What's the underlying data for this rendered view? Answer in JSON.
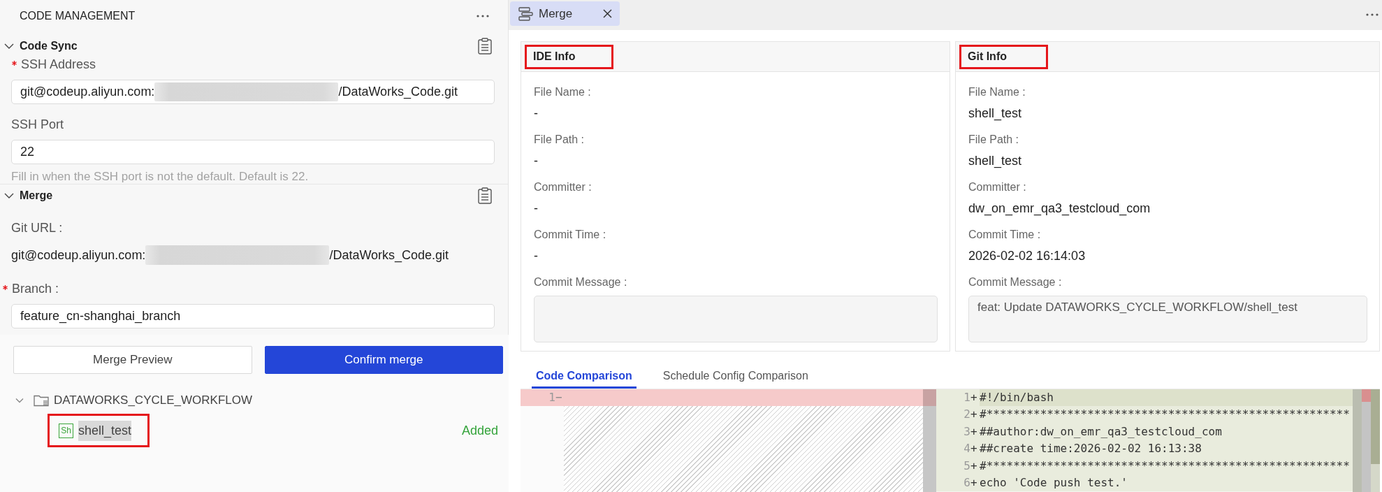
{
  "sidebar": {
    "title": "CODE MANAGEMENT",
    "sections": [
      {
        "title": "Code Sync",
        "expanded": true,
        "fields": [
          {
            "kind": "input",
            "label": "SSH Address",
            "required": true,
            "value": "git@codeup.aliyun.com:",
            "redacted": true,
            "value_end": "/DataWorks_Code.git"
          },
          {
            "kind": "input",
            "label": "SSH Port",
            "required": false,
            "value": "22",
            "redacted": false,
            "hint": "Fill in when the SSH port is not the default. Default is 22."
          }
        ]
      },
      {
        "title": "Merge",
        "expanded": true,
        "fields": [
          {
            "kind": "text",
            "label": "Git URL :",
            "required": false,
            "value": "git@codeup.aliyun.com:",
            "redacted": true,
            "value_end": "/DataWorks_Code.git"
          },
          {
            "kind": "input",
            "label": "Branch :",
            "required": true,
            "value": "feature_cn-shanghai_branch",
            "redacted": false
          }
        ]
      }
    ],
    "buttons": [
      {
        "label": "Merge Preview",
        "kind": "secondary"
      },
      {
        "label": "Confirm merge",
        "kind": "primary"
      }
    ],
    "tree": [
      {
        "kind": "folder",
        "name": "DATAWORKS_CYCLE_WORKFLOW",
        "expanded": true,
        "selected": false,
        "highlighted": false,
        "children": [
          {
            "kind": "file",
            "name": "shell_test",
            "type_label": "Sh",
            "status": "Added",
            "selected": true,
            "highlighted": true
          }
        ]
      }
    ]
  },
  "editor": {
    "tabs": [
      {
        "label": "Merge",
        "selected": true,
        "closable": true
      }
    ],
    "cards": [
      {
        "title": "IDE Info",
        "highlighted": true,
        "fields": [
          {
            "kind": "text",
            "label": "File Name :",
            "value": "-"
          },
          {
            "kind": "text",
            "label": "File Path :",
            "value": "-"
          },
          {
            "kind": "text",
            "label": "Committer :",
            "value": "-"
          },
          {
            "kind": "text",
            "label": "Commit Time :",
            "value": "-"
          },
          {
            "kind": "textarea",
            "label": "Commit Message :"
          }
        ]
      },
      {
        "title": "Git Info",
        "highlighted": true,
        "fields": [
          {
            "kind": "text",
            "label": "File Name :",
            "value": "shell_test"
          },
          {
            "kind": "text",
            "label": "File Path :",
            "value": "shell_test"
          },
          {
            "kind": "text",
            "label": "Committer :",
            "value": "dw_on_emr_qa3_testcloud_com"
          },
          {
            "kind": "text",
            "label": "Commit Time :",
            "value": "2026-02-02 16:14:03"
          },
          {
            "kind": "textarea",
            "label": "Commit Message :",
            "value": "feat: Update DATAWORKS_CYCLE_WORKFLOW/shell_test"
          }
        ]
      }
    ],
    "comparison_tabs": [
      {
        "label": "Code Comparison",
        "selected": true
      },
      {
        "label": "Schedule Config Comparison",
        "selected": false
      }
    ],
    "diff": {
      "original": [
        {
          "kind": "removed",
          "number": "1",
          "sign": "−"
        }
      ],
      "modified": [
        {
          "kind": "added",
          "number": "1",
          "sign": "+",
          "text": "#!/bin/bash",
          "current": true
        },
        {
          "kind": "added",
          "number": "2",
          "sign": "+",
          "text": "#******************************************************",
          "current": false
        },
        {
          "kind": "added",
          "number": "3",
          "sign": "+",
          "text": "##author:dw_on_emr_qa3_testcloud_com",
          "current": false
        },
        {
          "kind": "added",
          "number": "4",
          "sign": "+",
          "text": "##create time:2026-02-02 16:13:38",
          "current": false
        },
        {
          "kind": "added",
          "number": "5",
          "sign": "+",
          "text": "#******************************************************",
          "current": false
        },
        {
          "kind": "added",
          "number": "6",
          "sign": "+",
          "text": "echo 'Code push test.'",
          "current": false
        }
      ]
    }
  }
}
